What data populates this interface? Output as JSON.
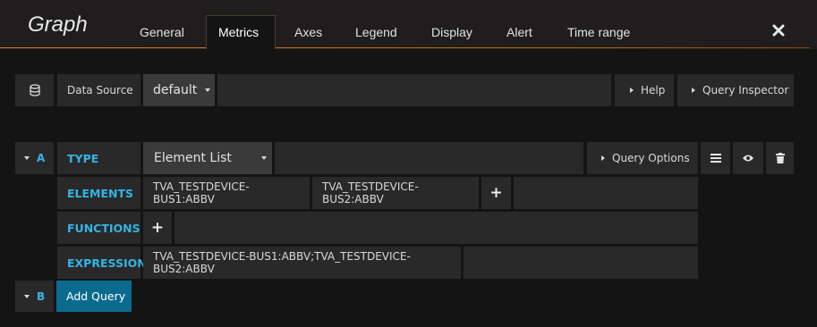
{
  "panel": {
    "title": "Graph",
    "tabs": [
      {
        "label": "General"
      },
      {
        "label": "Metrics"
      },
      {
        "label": "Axes"
      },
      {
        "label": "Legend"
      },
      {
        "label": "Display"
      },
      {
        "label": "Alert"
      },
      {
        "label": "Time range"
      }
    ],
    "active_tab": "Metrics",
    "close_icon": "close-icon"
  },
  "datasource": {
    "label": "Data Source",
    "value": "default",
    "help_label": "Help",
    "inspector_label": "Query Inspector"
  },
  "query_a": {
    "ref": "A",
    "type_label": "TYPE",
    "type_value": "Element List",
    "options_label": "Query Options",
    "elements_label": "ELEMENTS",
    "elements": [
      "TVA_TESTDEVICE-BUS1:ABBV",
      "TVA_TESTDEVICE-BUS2:ABBV"
    ],
    "functions_label": "FUNCTIONS",
    "expression_label": "EXPRESSION",
    "expression_value": "TVA_TESTDEVICE-BUS1:ABBV;TVA_TESTDEVICE-BUS2:ABBV"
  },
  "query_b": {
    "ref": "B",
    "add_label": "Add Query"
  },
  "colors": {
    "accent": "#33b5e5",
    "tab_underline": "#e97a1d",
    "add_button": "#0a6b8f"
  }
}
